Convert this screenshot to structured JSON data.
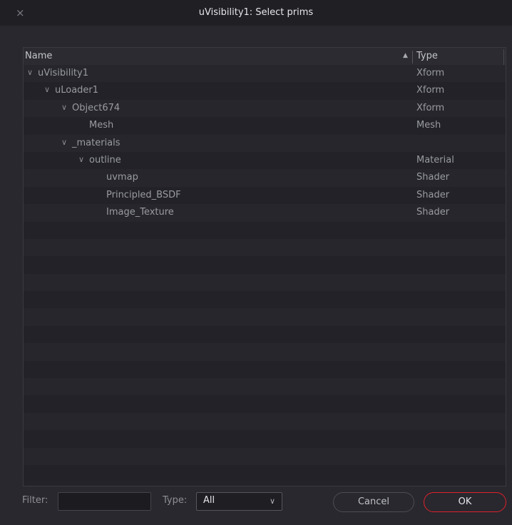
{
  "window": {
    "title": "uVisibility1: Select prims",
    "close_icon": "×"
  },
  "table": {
    "columns": {
      "name": "Name",
      "type": "Type"
    },
    "sort_icon": "▲",
    "rows": [
      {
        "label": "uVisibility1",
        "type": "Xform",
        "level": 0,
        "expanded": true
      },
      {
        "label": "uLoader1",
        "type": "Xform",
        "level": 1,
        "expanded": true
      },
      {
        "label": "Object674",
        "type": "Xform",
        "level": 2,
        "expanded": true
      },
      {
        "label": "Mesh",
        "type": "Mesh",
        "level": 3,
        "expanded": false
      },
      {
        "label": "_materials",
        "type": "",
        "level": 2,
        "expanded": true
      },
      {
        "label": "outline",
        "type": "Material",
        "level": 3,
        "expanded": true
      },
      {
        "label": "uvmap",
        "type": "Shader",
        "level": 4,
        "expanded": false
      },
      {
        "label": "Principled_BSDF",
        "type": "Shader",
        "level": 4,
        "expanded": false
      },
      {
        "label": "Image_Texture",
        "type": "Shader",
        "level": 4,
        "expanded": false
      }
    ],
    "chevron_icon": "∨"
  },
  "footer": {
    "filter_label": "Filter:",
    "filter_value": "",
    "type_label": "Type:",
    "type_value": "All",
    "cancel_label": "Cancel",
    "ok_label": "OK"
  }
}
